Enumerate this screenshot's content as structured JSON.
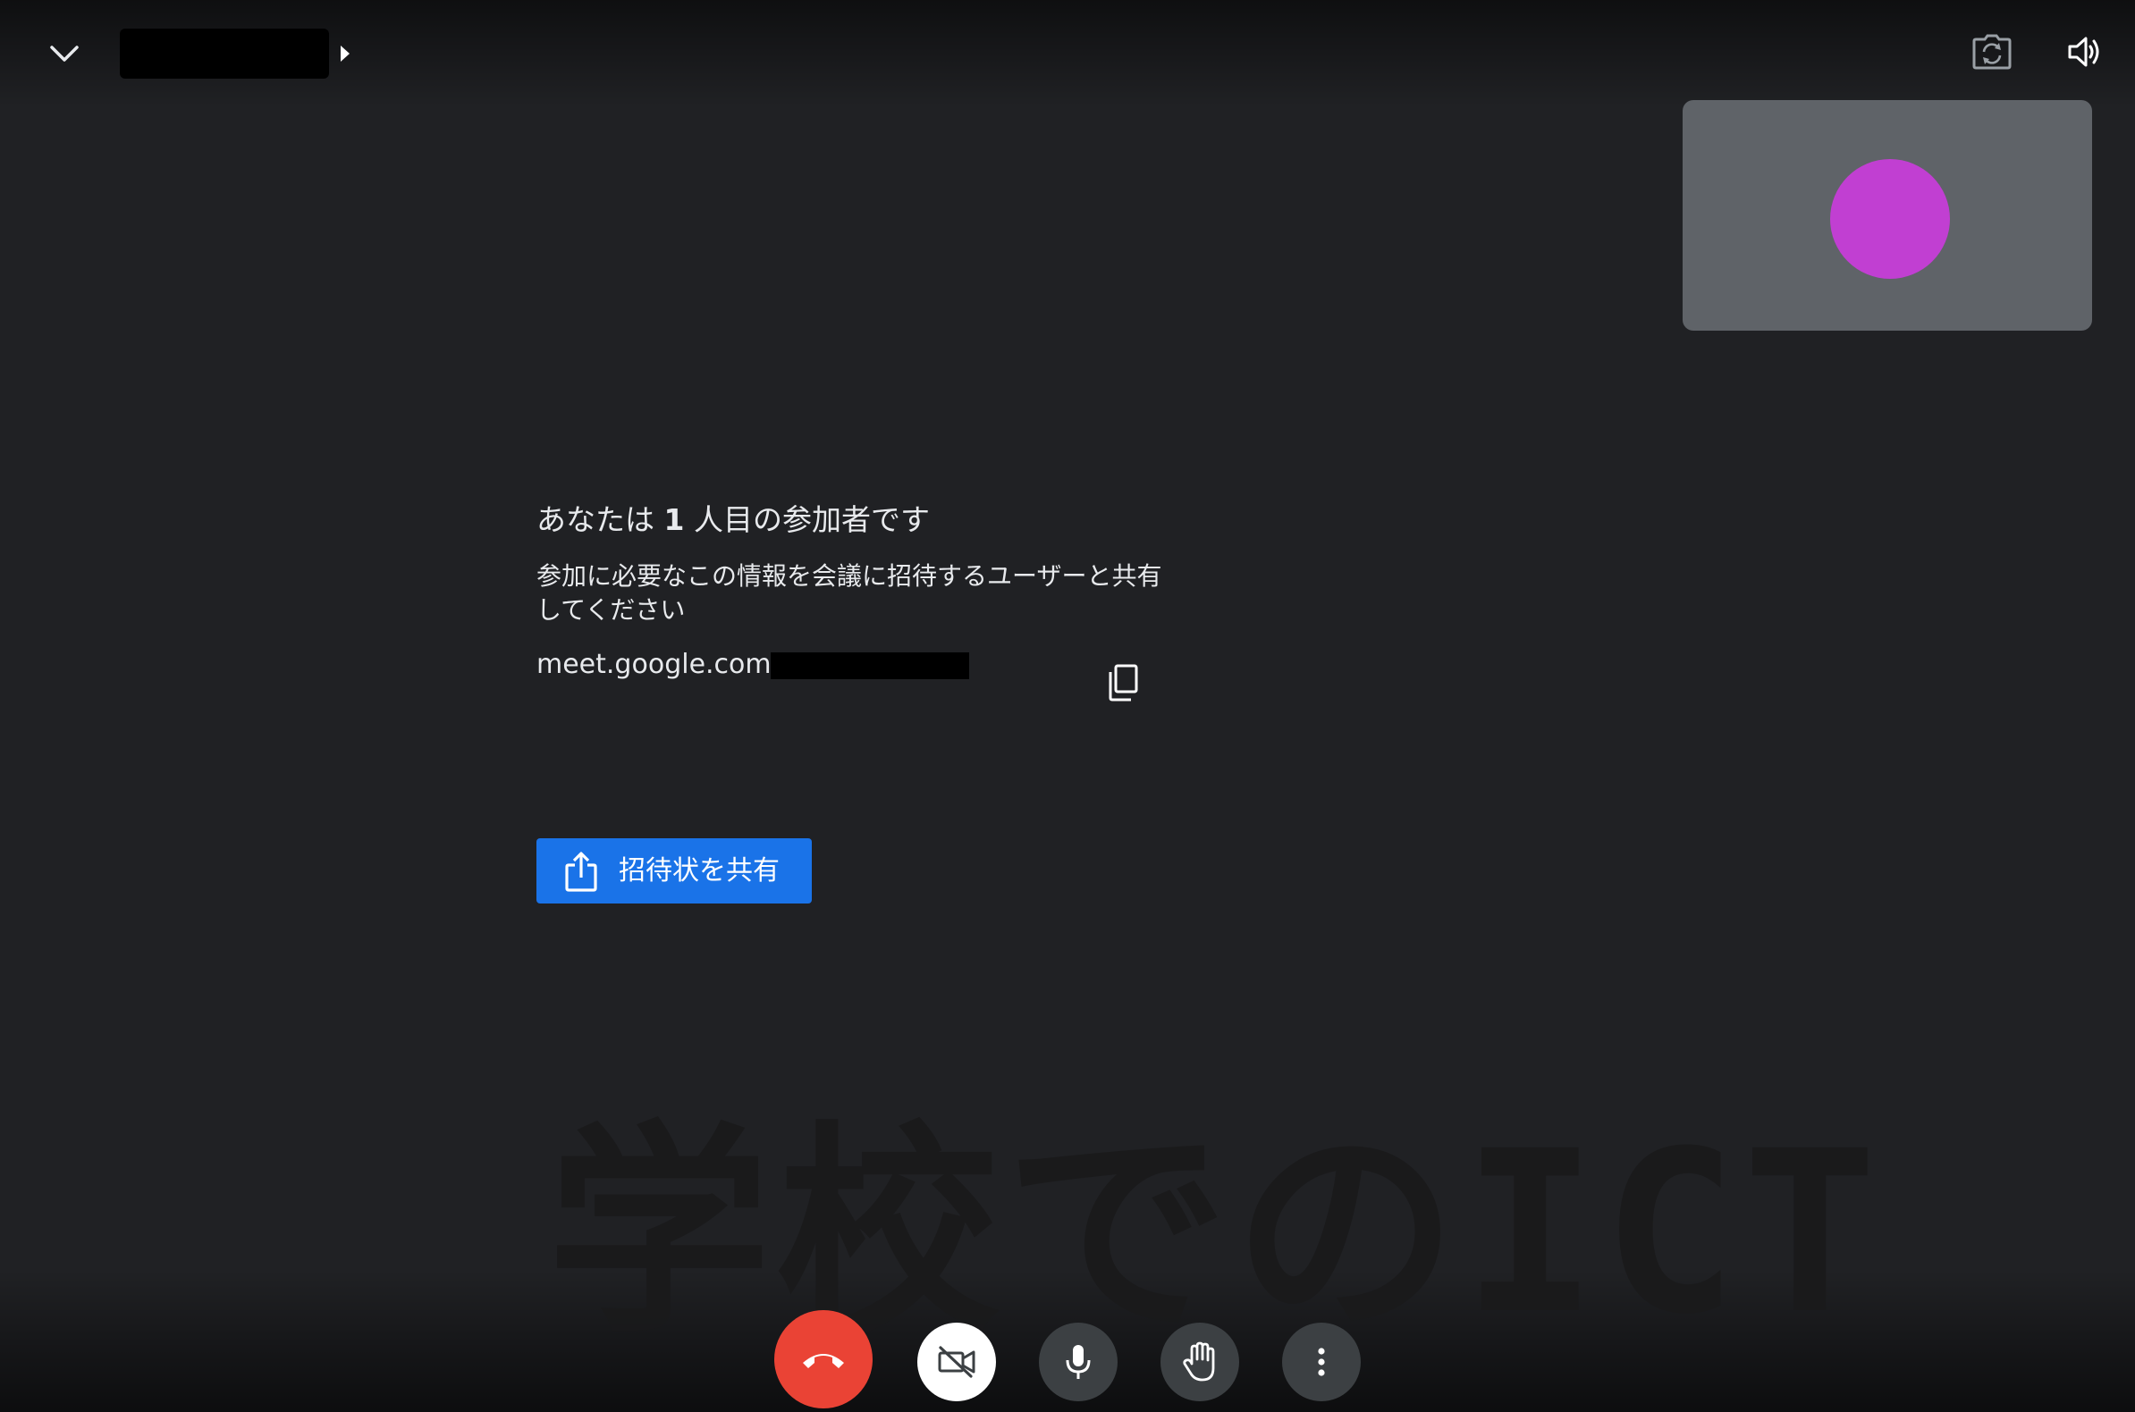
{
  "info": {
    "heading_prefix": "あなたは ",
    "heading_number": "1",
    "heading_suffix": " 人目の参加者です",
    "description": "参加に必要なこの情報を会議に招待するユーザーと共有してください",
    "meet_link_prefix": "meet.google.com/"
  },
  "share_button": {
    "label": "招待状を共有"
  },
  "watermark": {
    "text": "学校でのICT"
  },
  "colors": {
    "background": "#202124",
    "self_view_tile": "#5f6368",
    "avatar": "#c13fd2",
    "primary_button": "#1a73e8",
    "leave_button": "#ea4335",
    "control_button": "#3c4043"
  },
  "icons": {
    "collapse": "chevron-down-icon",
    "title_arrow": "triangle-right-icon",
    "switch_camera": "switch-camera-icon",
    "speaker": "speaker-icon",
    "copy": "copy-icon",
    "share": "share-icon",
    "leave": "phone-hangup-icon",
    "camera": "camera-off-icon",
    "mic": "microphone-icon",
    "hand": "raise-hand-icon",
    "more": "more-vert-icon"
  }
}
